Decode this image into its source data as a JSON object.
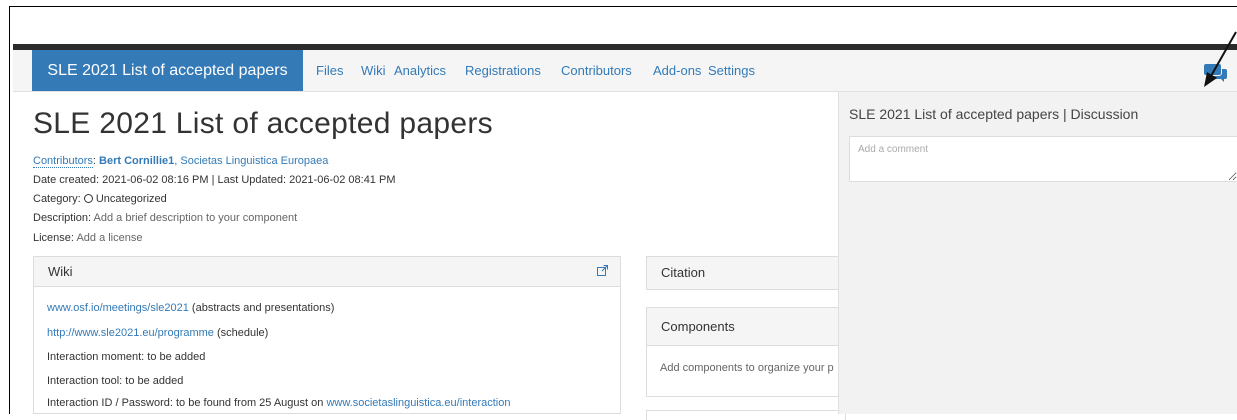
{
  "nav": {
    "project_title": "SLE 2021 List of accepted papers",
    "links": [
      "Files",
      "Wiki",
      "Analytics",
      "Registrations",
      "Contributors",
      "Add-ons",
      "Settings"
    ],
    "chat_icon": "speech-bubbles-icon"
  },
  "project": {
    "title": "SLE 2021 List of accepted papers",
    "contributors_label": "Contributors",
    "contributors": [
      "Bert Cornillie1",
      "Societas Linguistica Europaea"
    ],
    "date_created_label": "Date created:",
    "date_created": "2021-06-02 08:16 PM",
    "last_updated_label": "Last Updated:",
    "last_updated": "2021-06-02 08:41 PM",
    "category_label": "Category:",
    "category": "Uncategorized",
    "description_label": "Description:",
    "description": "Add a brief description to your component",
    "license_label": "License:",
    "license": "Add a license"
  },
  "wiki": {
    "heading": "Wiki",
    "lines": [
      {
        "link": "www.osf.io/meetings/sle2021",
        "text": " (abstracts and presentations)"
      },
      {
        "link": "http://www.sle2021.eu/programme",
        "text": " (schedule)"
      },
      {
        "text": "Interaction moment: to be added"
      },
      {
        "text": "Interaction tool: to be added"
      },
      {
        "text": "Interaction ID / Password: to be found from 25 August on ",
        "link": "www.societaslinguistica.eu/interaction"
      }
    ]
  },
  "citation": {
    "heading": "Citation"
  },
  "components": {
    "heading": "Components",
    "body": "Add components to organize your p"
  },
  "discussion": {
    "title": "SLE 2021 List of accepted papers | Discussion",
    "placeholder": "Add a comment"
  },
  "colors": {
    "brand": "#337ab7",
    "topbar": "#2b2b2b",
    "navbar": "#f5f5f5",
    "discussion_bg": "#f2f2f2"
  }
}
